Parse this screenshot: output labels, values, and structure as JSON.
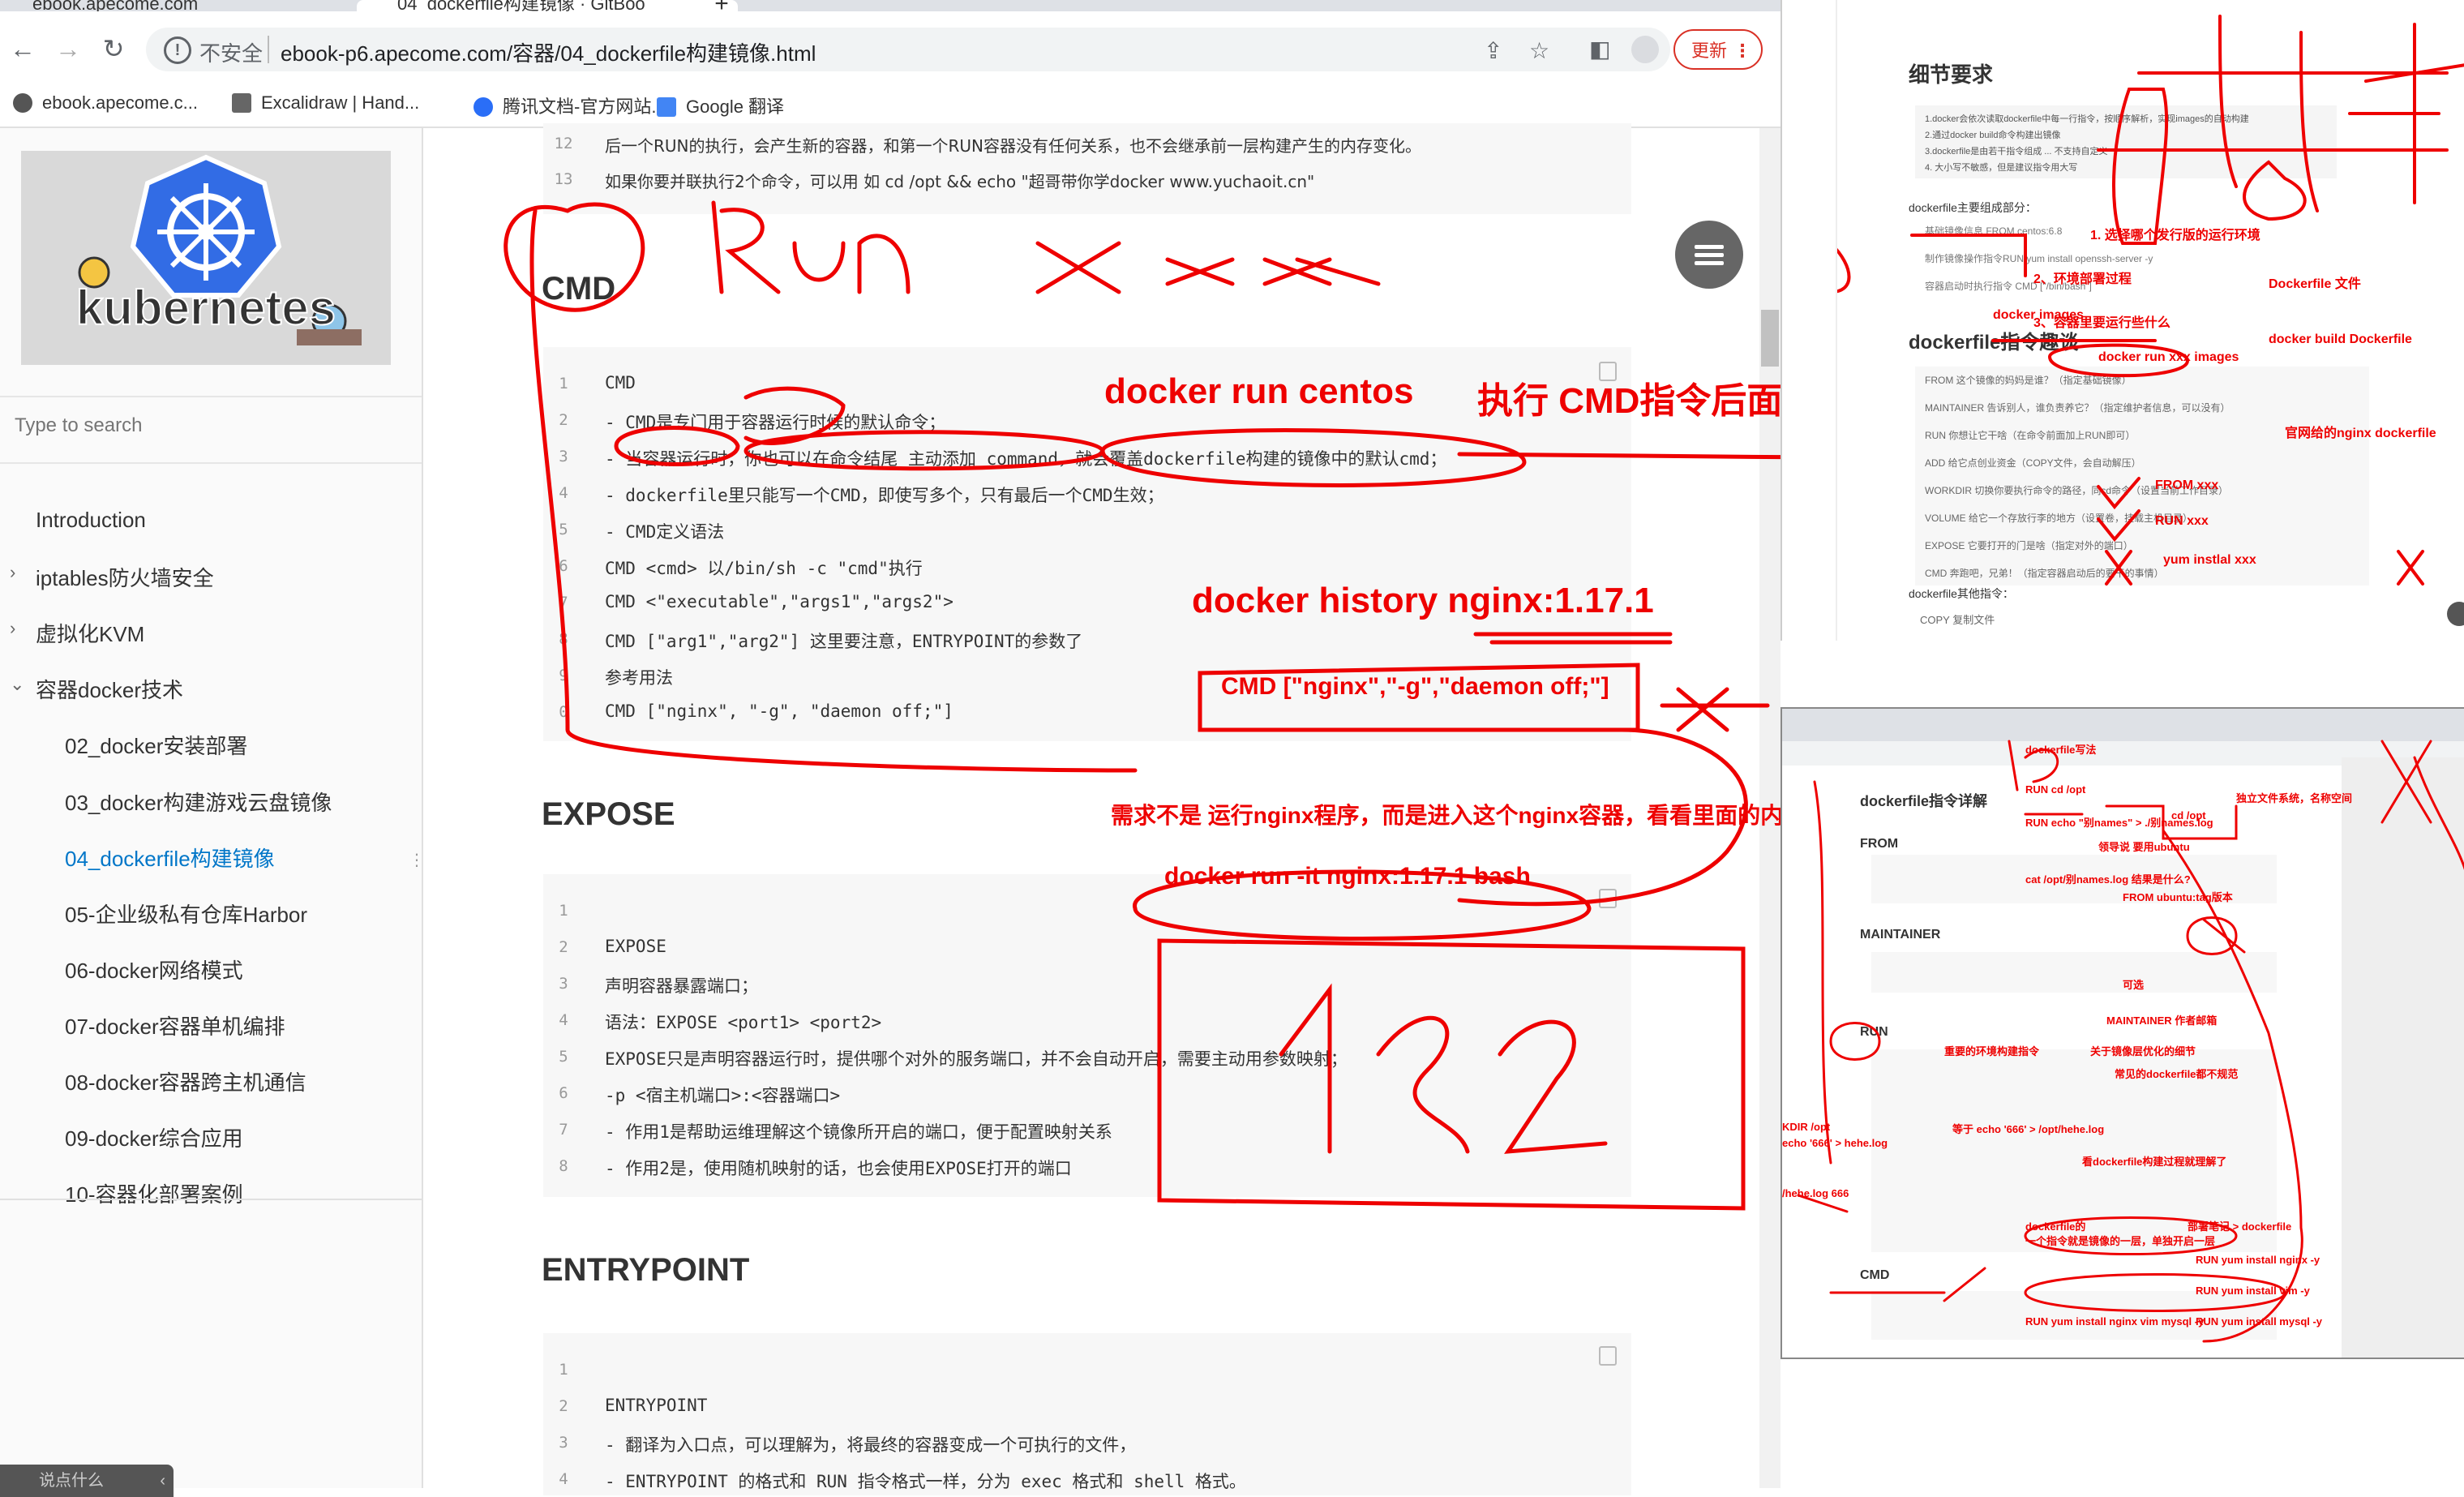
{
  "browser": {
    "tab1_title": "ebook.apecome.com",
    "tab2_title": "04_dockerfile构建镜像 · GitBoo",
    "new_tab_glyph": "+",
    "address_security": "不安全",
    "address_url": "ebook-p6.apecome.com/容器/04_dockerfile构建镜像.html",
    "update_button": "更新",
    "bookmarks": [
      "ebook.apecome.c...",
      "Excalidraw | Hand...",
      "腾讯文档-官方网站...",
      "Google 翻译"
    ]
  },
  "sidebar": {
    "logo_text": "kubernetes",
    "search_placeholder": "Type to search",
    "items": [
      {
        "label": "Introduction",
        "chev": ""
      },
      {
        "label": "iptables防火墙安全",
        "chev": "›"
      },
      {
        "label": "虚拟化KVM",
        "chev": "›"
      },
      {
        "label": "容器docker技术",
        "chev": "⌄"
      },
      {
        "label": "02_docker安装部署",
        "chev": ""
      },
      {
        "label": "03_docker构建游戏云盘镜像",
        "chev": ""
      },
      {
        "label": "04_dockerfile构建镜像",
        "chev": ""
      },
      {
        "label": "05-企业级私有仓库Harbor",
        "chev": ""
      },
      {
        "label": "06-docker网络模式",
        "chev": ""
      },
      {
        "label": "07-docker容器单机编排",
        "chev": ""
      },
      {
        "label": "08-docker容器跨主机通信",
        "chev": ""
      },
      {
        "label": "09-docker综合应用",
        "chev": ""
      },
      {
        "label": "10-容器化部署案例",
        "chev": ""
      }
    ],
    "footer": "说点什么"
  },
  "content": {
    "top_block": [
      {
        "n": "12",
        "t": "后一个RUN的执行，会产生新的容器，和第一个RUN容器没有任何关系，也不会继承前一层构建产生的内存变化。"
      },
      {
        "n": "13",
        "t": "如果你要并联执行2个命令，可以用 如 cd /opt && echo \"超哥带你学docker www.yuchaoit.cn\""
      }
    ],
    "cmd_heading": "CMD",
    "cmd_block": [
      {
        "n": "1",
        "t": "CMD"
      },
      {
        "n": "2",
        "t": "- CMD是专门用于容器运行时候的默认命令；"
      },
      {
        "n": "3",
        "t": "- 当容器运行时，你也可以在命令结尾 主动添加 command，就会覆盖dockerfile构建的镜像中的默认cmd；"
      },
      {
        "n": "4",
        "t": "- dockerfile里只能写一个CMD，即使写多个，只有最后一个CMD生效；"
      },
      {
        "n": "5",
        "t": "- CMD定义语法"
      },
      {
        "n": "6",
        "t": "CMD <cmd>  以/bin/sh -c \"cmd\"执行"
      },
      {
        "n": "7",
        "t": "CMD <\"executable\",\"args1\",\"args2\">"
      },
      {
        "n": "8",
        "t": "CMD [\"arg1\",\"arg2\"]   这里要注意，ENTRYPOINT的参数了"
      },
      {
        "n": "9",
        "t": "参考用法"
      },
      {
        "n": "0",
        "t": "CMD [\"nginx\", \"-g\", \"daemon off;\"]"
      }
    ],
    "expose_heading": "EXPOSE",
    "expose_block": [
      {
        "n": "1",
        "t": ""
      },
      {
        "n": "2",
        "t": "EXPOSE"
      },
      {
        "n": "3",
        "t": "声明容器暴露端口；"
      },
      {
        "n": "4",
        "t": "语法：EXPOSE <port1> <port2>"
      },
      {
        "n": "5",
        "t": "EXPOSE只是声明容器运行时，提供哪个对外的服务端口，并不会自动开启，需要主动用参数映射；"
      },
      {
        "n": "6",
        "t": "-p <宿主机端口>:<容器端口>"
      },
      {
        "n": "7",
        "t": "- 作用1是帮助运维理解这个镜像所开启的端口，便于配置映射关系"
      },
      {
        "n": "8",
        "t": "- 作用2是，使用随机映射的话，也会使用EXPOSE打开的端口"
      }
    ],
    "entrypoint_heading": "ENTRYPOINT",
    "entrypoint_block": [
      {
        "n": "1",
        "t": ""
      },
      {
        "n": "2",
        "t": "ENTRYPOINT"
      },
      {
        "n": "3",
        "t": "- 翻译为入口点，可以理解为，将最终的容器变成一个可执行的文件，"
      },
      {
        "n": "4",
        "t": "- ENTRYPOINT 的格式和 RUN 指令格式一样，分为 exec 格式和 shell 格式。"
      }
    ]
  },
  "annotations": {
    "run_xxx": "Run  x  xxx",
    "docker_run_centos": "docker run  centos",
    "exec_cmd": "执行 CMD指令后面的内容",
    "docker_history": "docker history  nginx:1.17.1",
    "cmd_nginx": "CMD  [\"nginx\",\"-g\",\"daemon off;\"]",
    "need_text": "需求不是 运行nginx程序，而是进入这个nginx容器，看看里面的内容",
    "docker_run_bash": "docker run  -it  nginx:1.17.1   bash",
    "big_number": "192"
  },
  "right_pane_top": {
    "heading1": "细节要求",
    "items": [
      "1.docker会依次读取dockerfile中每一行指令，按顺序解析，实现images的自动构建",
      "2.通过docker build命令构建出镜像",
      "3.dockerfile是由若干指令组成 ... 不支持自定义",
      "4. 大小写不敏感，但是建议指令用大写"
    ],
    "composition": "dockerfile主要组成部分：",
    "parts": [
      "基础镜像信息 FROM centos:6.8",
      "制作镜像操作指令RUN yum install openssh-server -y",
      "容器启动时执行指令 CMD [\"/bin/bash\"]"
    ],
    "heading2": "dockerfile指令趣谈",
    "instructions": [
      "FROM 这个镜像的妈妈是谁？（指定基础镜像）",
      "MAINTAINER 告诉别人，谁负责养它？（指定维护者信息，可以没有）",
      "RUN 你想让它干啥（在命令前面加上RUN即可）",
      "ADD 给它点创业资金（COPY文件，会自动解压）",
      "WORKDIR 切换你要执行命令的路径，同cd命令（设置当前工作目录）",
      "VOLUME 给它一个存放行李的地方（设置卷，挂载主机目录）",
      "EXPOSE 它要打开的门是啥（指定对外的端口）",
      "CMD 奔跑吧，兄弟！（指定容器启动后的要干的事情）"
    ],
    "other": "dockerfile其他指令：",
    "copy": "COPY 复制文件",
    "ann": [
      "1. 选择哪个发行版的运行环境",
      "2、环境部署过程",
      "3、容器里要运行些什么",
      "Dockerfile  文件",
      "docker images",
      "docker build   Dockerfile",
      "docker  run  xxx  images",
      "官网给的nginx  dockerfile",
      "FROM  xxx",
      "RUN  xxx",
      "yum instlal  xxx"
    ]
  },
  "right_pane_bottom": {
    "headings": [
      "dockerfile指令详解",
      "FROM",
      "MAINTAINER",
      "RUN",
      "CMD"
    ],
    "ann": [
      "dockerfile写法",
      "RUN cd /opt",
      "RUN echo \"别names\" > ./别names.log",
      "cd /opt",
      "领导说 要用ubuntu",
      "cat /opt/别names.log 结果是什么?",
      "FROM  ubuntu:tag版本",
      "可选",
      "MAINTAINER 作者邮箱",
      "重要的环境构建指令",
      "关于镜像层优化的细节",
      "常见的dockerfile都不规范",
      "等于  echo '666' > /opt/hehe.log",
      "看dockerfile构建过程就理解了",
      "dockerfile的",
      "一个指令就是镜像的一层，单独开启一层",
      "部署笔记 > dockerfile",
      "RUN yum install nginx -y",
      "RUN yum install vim  -y",
      "RUN  yum install nginx vim mysql -y",
      "RUN  yum install mysql -y",
      "独立文件系统，名称空间",
      "KDIR /opt",
      "echo '666' > hehe.log",
      "/hehe.log  666"
    ]
  }
}
